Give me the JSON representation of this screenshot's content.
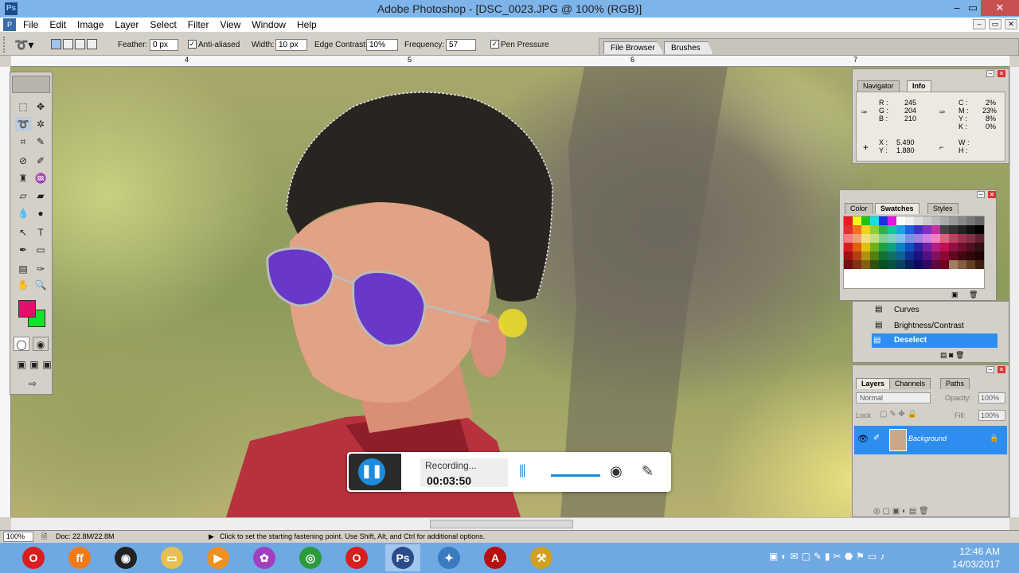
{
  "window": {
    "title": "Adobe Photoshop - [DSC_0023.JPG @ 100% (RGB)]"
  },
  "menu": [
    "File",
    "Edit",
    "Image",
    "Layer",
    "Select",
    "Filter",
    "View",
    "Window",
    "Help"
  ],
  "options": {
    "feather_label": "Feather:",
    "feather_value": "0 px",
    "anti_aliased": "Anti-aliased",
    "width_label": "Width:",
    "width_value": "10 px",
    "edge_contrast_label": "Edge Contrast:",
    "edge_contrast_value": "10%",
    "frequency_label": "Frequency:",
    "frequency_value": "57",
    "pen_pressure": "Pen Pressure"
  },
  "palette_well": {
    "file_browser": "File Browser",
    "brushes": "Brushes"
  },
  "ruler": {
    "marks": [
      "4",
      "5",
      "6",
      "7"
    ]
  },
  "info_panel": {
    "tabs": [
      "Navigator",
      "Info"
    ],
    "r_label": "R :",
    "r": "245",
    "g_label": "G :",
    "g": "204",
    "b_label": "B :",
    "b": "210",
    "c_label": "C :",
    "c": "2%",
    "m_label": "M :",
    "m": "23%",
    "y_label": "Y :",
    "y": "8%",
    "k_label": "K :",
    "k": "0%",
    "x_label": "X :",
    "x": "5.490",
    "yy_label": "Y :",
    "yy": "1.880",
    "w_label": "W :",
    "h_label": "H :"
  },
  "swatches_panel": {
    "tabs": [
      "Color",
      "Swatches",
      "Styles"
    ]
  },
  "history_panel": {
    "items": [
      "Curves",
      "Brightness/Contrast",
      "Deselect"
    ]
  },
  "layers_panel": {
    "tabs": [
      "Layers",
      "Channels",
      "Paths"
    ],
    "blend_mode": "Normal",
    "opacity_label": "Opacity:",
    "opacity": "100%",
    "lock_label": "Lock:",
    "fill_label": "Fill:",
    "fill": "100%",
    "layer_name": "Background"
  },
  "recording": {
    "status": "Recording...",
    "time": "00:03:50"
  },
  "statusbar": {
    "zoom": "100%",
    "doc": "Doc: 22.8M/22.8M",
    "hint": "Click to set the starting fastening point.  Use Shift, Alt, and Ctrl for additional options."
  },
  "taskbar": {
    "time": "12:46 AM",
    "date": "14/03/2017"
  },
  "colors": {
    "foreground": "#e0106c",
    "background": "#16e02c",
    "title_bar": "#7eb4ea",
    "taskbar": "#6fa9e4",
    "selection_blue": "#2e8ef0"
  },
  "icons": {
    "opera": "opera-icon",
    "firefox": "firefox-icon",
    "camera": "webcam-icon",
    "folder": "folder-icon",
    "media": "media-player-icon",
    "picasa": "picasa-icon",
    "chrome": "chrome-icon",
    "opera2": "opera-icon",
    "photoshop": "photoshop-icon",
    "safari": "compass-icon",
    "acrobat": "acrobat-icon",
    "tools": "tools-icon"
  }
}
